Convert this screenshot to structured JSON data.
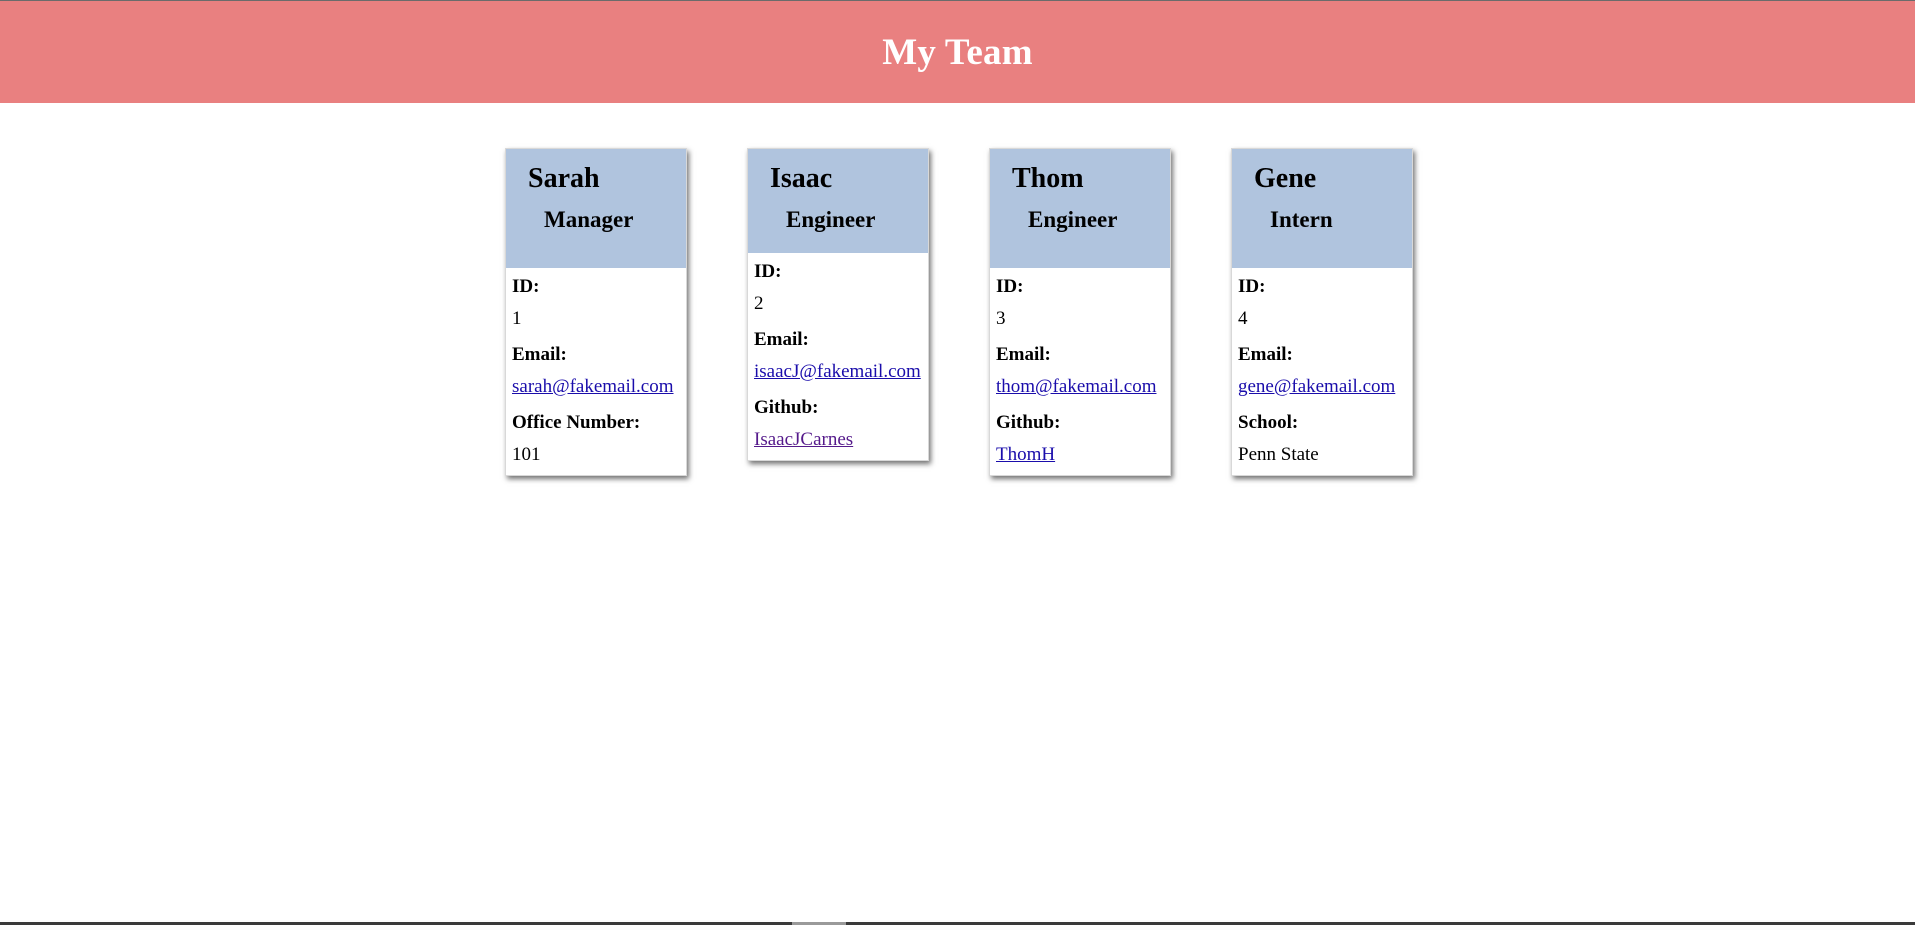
{
  "header": {
    "title": "My Team"
  },
  "colors": {
    "header_bg": "#e98080",
    "card_head_bg": "#b0c4de",
    "link": "#1a0dab",
    "link_visited": "#551a8b"
  },
  "cards": [
    {
      "name": "Sarah",
      "role": "Manager",
      "fields": [
        {
          "label": "ID:",
          "value": "1"
        },
        {
          "label": "Email:",
          "value": "sarah@fakemail.com"
        },
        {
          "label": "Office Number:",
          "value": "101"
        }
      ]
    },
    {
      "name": "Isaac",
      "role": "Engineer",
      "fields": [
        {
          "label": "ID:",
          "value": "2"
        },
        {
          "label": "Email:",
          "value": "isaacJ@fakemail.com"
        },
        {
          "label": "Github:",
          "value": "IsaacJCarnes"
        }
      ]
    },
    {
      "name": "Thom",
      "role": "Engineer",
      "fields": [
        {
          "label": "ID:",
          "value": "3"
        },
        {
          "label": "Email:",
          "value": "thom@fakemail.com"
        },
        {
          "label": "Github:",
          "value": "ThomH"
        }
      ]
    },
    {
      "name": "Gene",
      "role": "Intern",
      "fields": [
        {
          "label": "ID:",
          "value": "4"
        },
        {
          "label": "Email:",
          "value": "gene@fakemail.com"
        },
        {
          "label": "School:",
          "value": "Penn State"
        }
      ]
    }
  ]
}
